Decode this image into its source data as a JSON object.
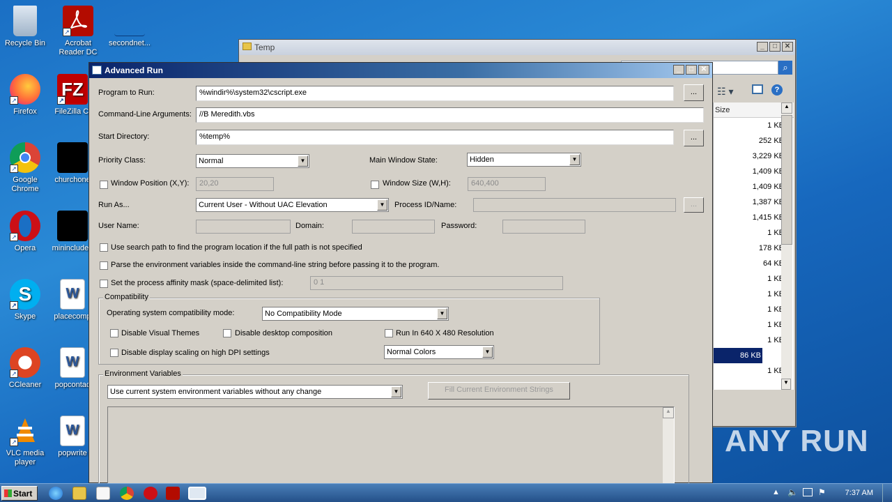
{
  "desktop": {
    "icons": [
      {
        "label": "Recycle Bin",
        "icon": "recycle-bin-icon"
      },
      {
        "label": "Acrobat Reader DC",
        "icon": "acrobat-icon"
      },
      {
        "label": "secondnet...",
        "icon": "file-icon"
      },
      {
        "label": "Firefox",
        "icon": "firefox-icon"
      },
      {
        "label": "FileZilla Cl",
        "icon": "filezilla-icon"
      },
      {
        "label": "Google Chrome",
        "icon": "chrome-icon"
      },
      {
        "label": "churchone",
        "icon": "file-icon"
      },
      {
        "label": "Opera",
        "icon": "opera-icon"
      },
      {
        "label": "minincluded",
        "icon": "file-icon"
      },
      {
        "label": "Skype",
        "icon": "skype-icon"
      },
      {
        "label": "placecomp",
        "icon": "word-icon"
      },
      {
        "label": "CCleaner",
        "icon": "ccleaner-icon"
      },
      {
        "label": "popcontac",
        "icon": "word-icon"
      },
      {
        "label": "VLC media player",
        "icon": "vlc-icon"
      },
      {
        "label": "popwrite",
        "icon": "word-icon"
      }
    ]
  },
  "temp_window": {
    "title": "Temp",
    "column_size": "Size",
    "sizes": [
      "1 KB",
      "252 KB",
      "3,229 KB",
      "1,409 KB",
      "1,409 KB",
      "1,387 KB",
      "1,415 KB",
      "1 KB",
      "178 KB",
      "64 KB",
      "1 KB",
      "1 KB",
      "1 KB",
      "1 KB",
      "1 KB",
      "86 KB",
      "1 KB"
    ],
    "selected_index": 15
  },
  "advanced_run": {
    "title": "Advanced Run",
    "program_label": "Program to Run:",
    "program_value": "%windir%\\system32\\cscript.exe",
    "browse_label": "...",
    "args_label": "Command-Line Arguments:",
    "args_value": "//B Meredith.vbs",
    "startdir_label": "Start Directory:",
    "startdir_value": "%temp%",
    "priority_label": "Priority Class:",
    "priority_value": "Normal",
    "winstate_label": "Main Window State:",
    "winstate_value": "Hidden",
    "winpos_label": "Window Position (X,Y):",
    "winpos_value": "20,20",
    "winsize_label": "Window Size (W,H):",
    "winsize_value": "640,400",
    "runas_label": "Run As...",
    "runas_value": "Current User - Without UAC Elevation",
    "procid_label": "Process ID/Name:",
    "username_label": "User Name:",
    "domain_label": "Domain:",
    "password_label": "Password:",
    "opt_searchpath": "Use search path to find the program location if the full path is not specified",
    "opt_parseenv": "Parse the environment variables inside the command-line string before passing it to the program.",
    "opt_affinity": "Set the process affinity mask (space-delimited list):",
    "affinity_value": "0 1",
    "compat_title": "Compatibility",
    "compat_mode_label": "Operating system compatibility mode:",
    "compat_mode_value": "No Compatibility Mode",
    "disable_themes": "Disable Visual Themes",
    "disable_desktop_comp": "Disable desktop composition",
    "run_640": "Run In 640 X 480 Resolution",
    "disable_dpi": "Disable display scaling on high DPI settings",
    "colors_value": "Normal Colors",
    "env_title": "Environment Variables",
    "env_mode_value": "Use current system environment variables without any change",
    "fill_env_label": "Fill Current Environment Strings"
  },
  "taskbar": {
    "start_label": "Start",
    "clock": "7:37 AM"
  },
  "watermark": "ANY RUN"
}
